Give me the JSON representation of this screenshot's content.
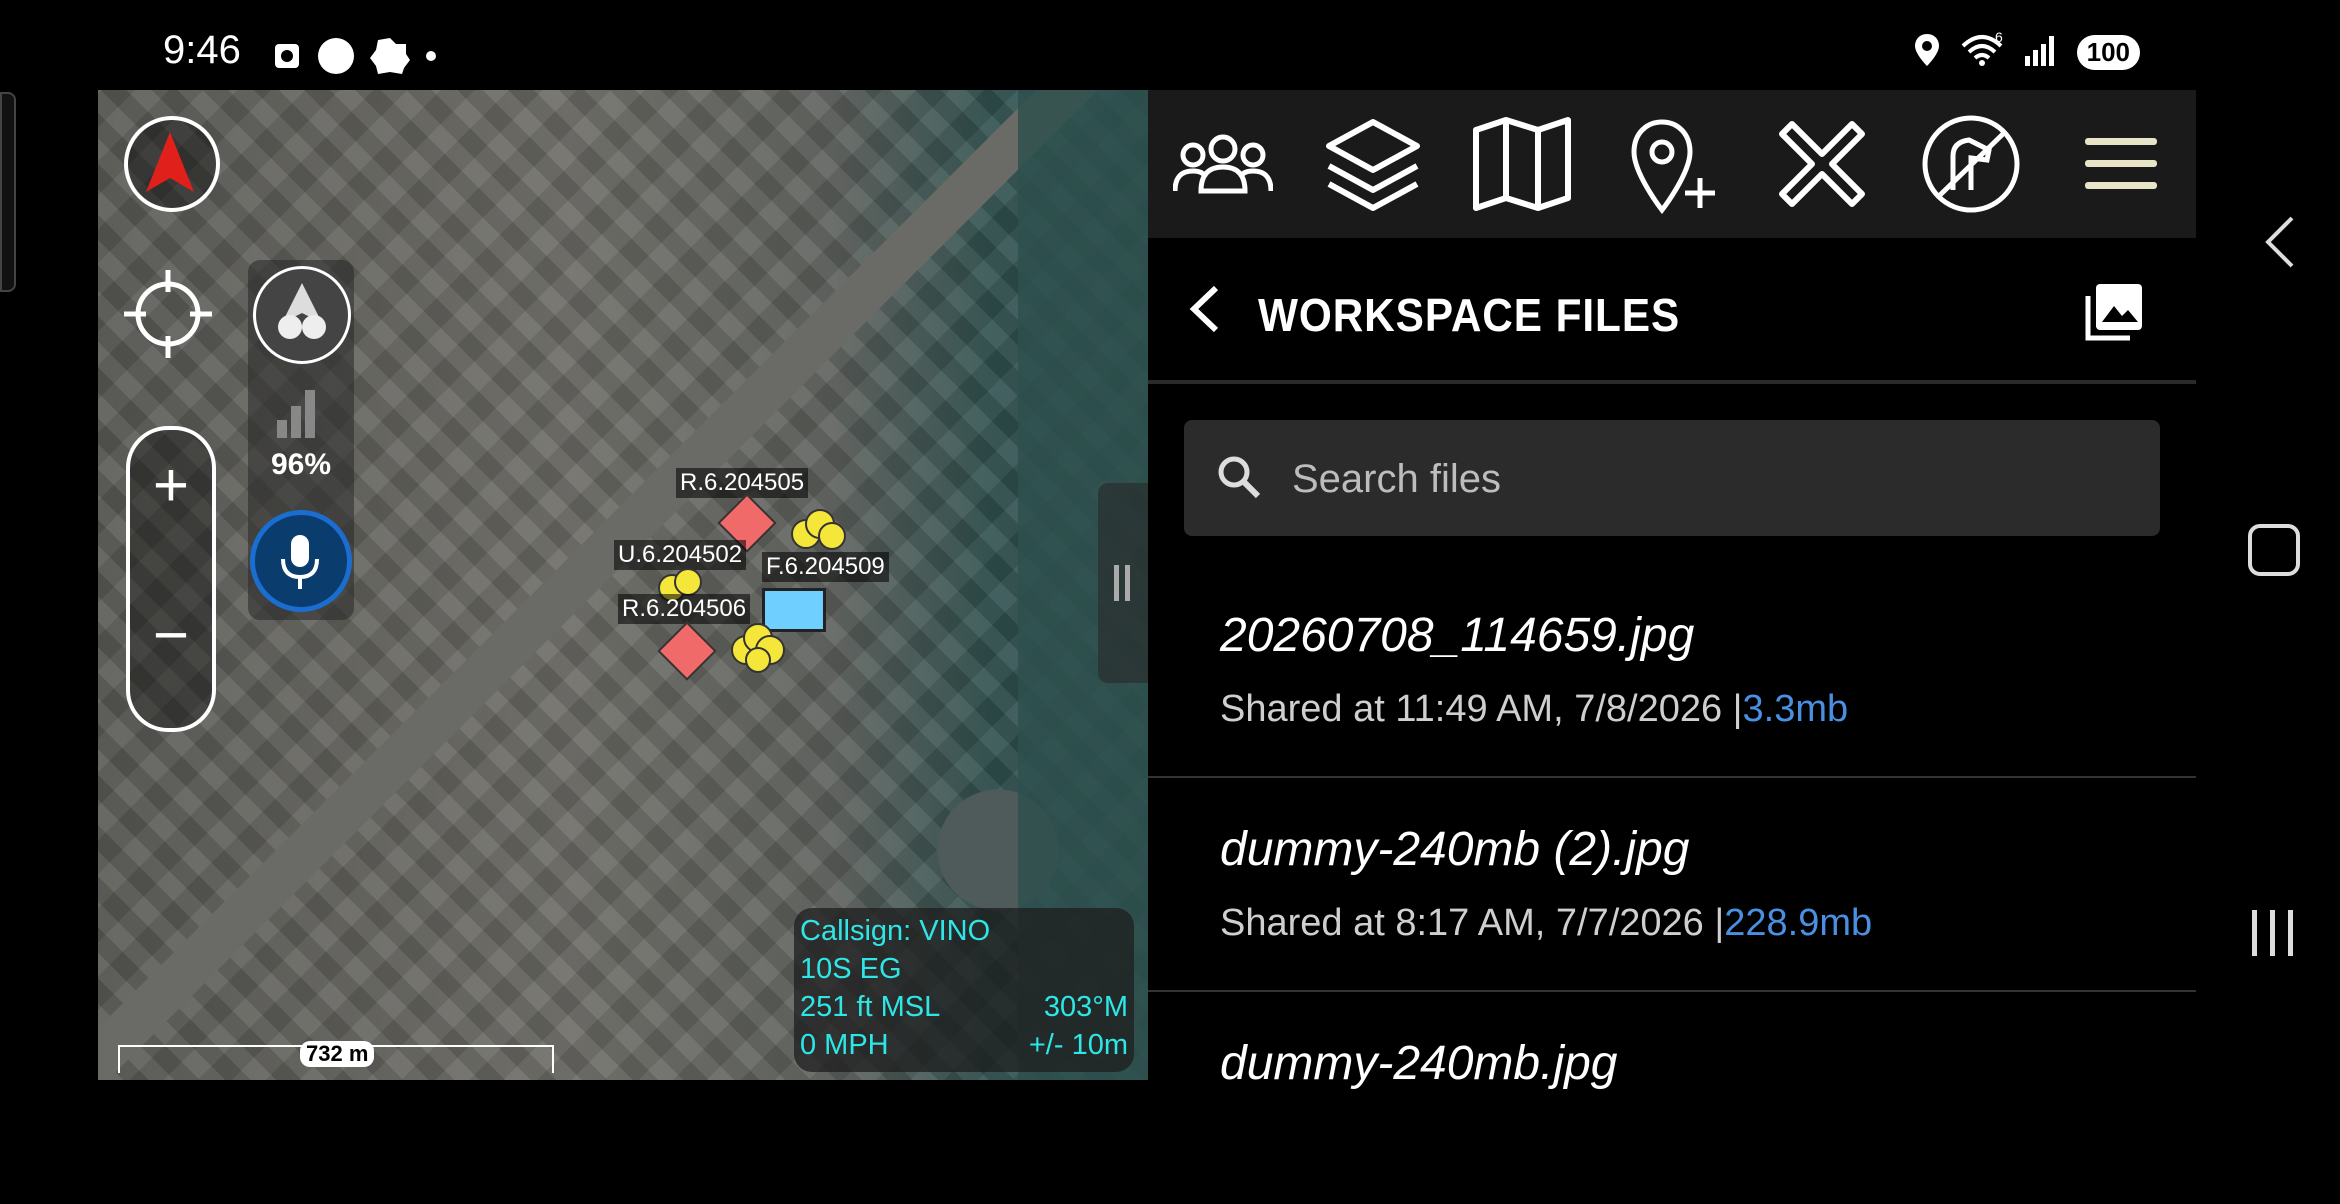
{
  "status_bar": {
    "time": "9:46",
    "network": "6",
    "battery": "100"
  },
  "map": {
    "signal_percent": "96%",
    "markers": [
      {
        "label": "R.6.204505",
        "shape": "diamond-red"
      },
      {
        "label": "U.6.204502",
        "shape": "cloud-yellow"
      },
      {
        "label": "F.6.204509",
        "shape": "rect-blue"
      },
      {
        "label": "R.6.204506",
        "shape": "diamond-red"
      }
    ],
    "info": {
      "callsign": "Callsign: VINO",
      "grid": "10S  EG",
      "altitude": "251 ft MSL",
      "heading": "303°M",
      "speed": "0 MPH",
      "accuracy": "+/- 10m"
    },
    "scale": "732 m"
  },
  "toolbar": {
    "icons": [
      "contacts-icon",
      "layers-icon",
      "map-icon",
      "add-point-icon",
      "close-x-icon",
      "dog-icon",
      "hamburger-menu-icon"
    ]
  },
  "panel": {
    "title": "WORKSPACE FILES",
    "search_placeholder": "Search files",
    "files": [
      {
        "name": "20260708_114659.jpg",
        "shared": "Shared at 11:49 AM, 7/8/2026 |",
        "size": "3.3mb"
      },
      {
        "name": "dummy-240mb (2).jpg",
        "shared": "Shared at 8:17 AM, 7/7/2026 |",
        "size": "228.9mb"
      },
      {
        "name": "dummy-240mb.jpg",
        "shared": "",
        "size": ""
      }
    ]
  },
  "colors": {
    "accent_blue": "#4a90e2",
    "info_cyan": "#2ee6e6",
    "marker_red": "#f06a6a",
    "marker_yellow": "#f5e63a",
    "marker_blue": "#6fd0ff"
  }
}
